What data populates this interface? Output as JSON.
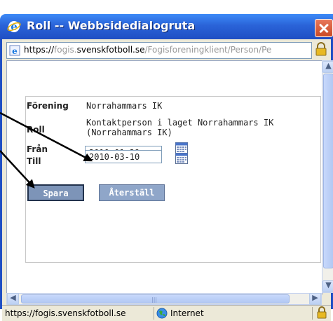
{
  "window": {
    "title": "Roll -- Webbsidedialogruta",
    "url_secure_prefix": "https://",
    "url_host_prefix": "fogis.",
    "url_host_main": "svenskfotboll.se",
    "url_path": "/Fogisforeningklient/Person/Pe"
  },
  "form": {
    "forening_label": "Förening",
    "forening_value": "Norrahammars IK",
    "roll_label": "Roll",
    "roll_value_line1": "Kontaktperson i laget Norrahammars IK",
    "roll_value_line2": "(Norrahammars IK)",
    "fran_label": "Från",
    "fran_value": "2010-01-29",
    "till_label": "Till",
    "till_value": "2010-03-10",
    "save_label": "Spara",
    "reset_label": "Återställ"
  },
  "statusbar": {
    "url": "https://fogis.svenskfotboll.se",
    "zone": "Internet"
  },
  "icons": [
    "ie-icon",
    "close-icon",
    "ie-page-icon",
    "lock-icon",
    "calendar-icon",
    "globe-icon",
    "scroll-up-icon",
    "scroll-down-icon",
    "scroll-left-icon",
    "scroll-right-icon"
  ],
  "colors": {
    "titlebar": "#2a63d8",
    "button": "#7d94b8",
    "frame": "#ece9d8"
  }
}
